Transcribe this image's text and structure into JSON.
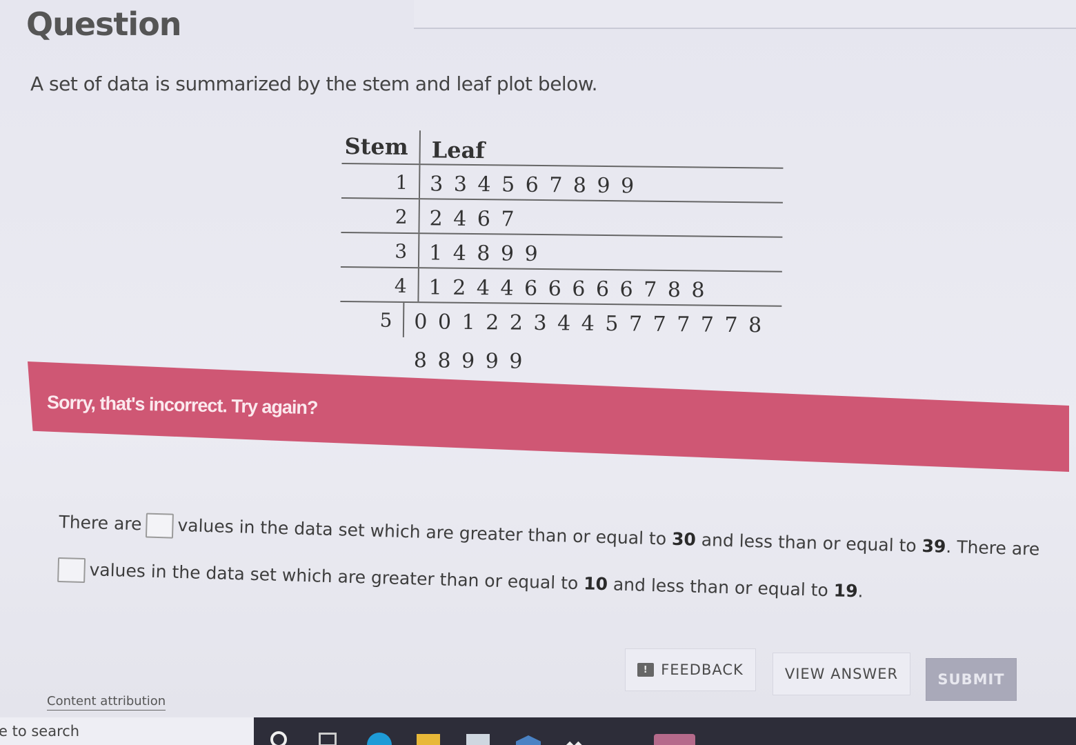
{
  "question": {
    "title": "Question",
    "prompt": "A set of data is summarized by the stem and leaf plot below."
  },
  "stem_leaf": {
    "stem_header": "Stem",
    "leaf_header": "Leaf",
    "rows": [
      {
        "stem": "1",
        "leaves": "3 3 4 5 6 7 8 9 9"
      },
      {
        "stem": "2",
        "leaves": "2 4 6 7"
      },
      {
        "stem": "3",
        "leaves": "1 4 8 9 9"
      },
      {
        "stem": "4",
        "leaves": "1 2 4 4 6 6 6 6 6 7 8 8"
      },
      {
        "stem": "5",
        "leaves": "0 0 1 2 2 3 4 4 5 7 7 7 7 7 8 8 8 9 9 9"
      }
    ]
  },
  "feedback_banner": {
    "text": "Sorry, that's incorrect. Try again?",
    "color": "#cf5774"
  },
  "answer": {
    "line1_prefix": "There are",
    "line1_middle": "values in the data set which are greater than or equal to",
    "line1_low": "30",
    "line1_and": "and less than or equal to",
    "line1_high": "39",
    "line1_suffix": ". There are",
    "line2_middle": "values in the data set which are greater than or equal to",
    "line2_low": "10",
    "line2_and": "and less than or equal to",
    "line2_high": "19",
    "line2_suffix": ".",
    "blank1_value": "",
    "blank2_value": ""
  },
  "buttons": {
    "feedback": "FEEDBACK",
    "feedback_icon": "exclamation-icon",
    "view_answer": "VIEW ANSWER",
    "submit": "SUBMIT"
  },
  "footer": {
    "attribution": "Content attribution"
  },
  "taskbar": {
    "search_text": "e to search",
    "icons": [
      "cortana-icon",
      "task-view-icon",
      "edge-icon",
      "file-explorer-icon",
      "store-icon",
      "mail-icon",
      "people-icon",
      "app-icon"
    ]
  }
}
